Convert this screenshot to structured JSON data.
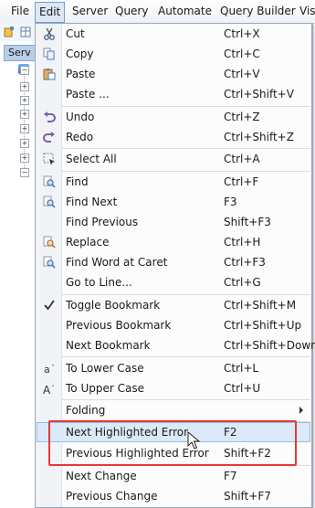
{
  "menubar": {
    "items": [
      {
        "label": "File"
      },
      {
        "label": "Edit"
      },
      {
        "label": "Server"
      },
      {
        "label": "Query"
      },
      {
        "label": "Automate"
      },
      {
        "label": "Query Builder"
      },
      {
        "label": "Visu"
      }
    ]
  },
  "background": {
    "tab_label": "Serv"
  },
  "menu": {
    "items": [
      {
        "label": "Cut",
        "shortcut": "Ctrl+X",
        "icon": "scissors-icon"
      },
      {
        "label": "Copy",
        "shortcut": "Ctrl+C",
        "icon": "copy-icon"
      },
      {
        "label": "Paste",
        "shortcut": "Ctrl+V",
        "icon": "paste-icon"
      },
      {
        "label": "Paste ...",
        "shortcut": "Ctrl+Shift+V",
        "icon": ""
      },
      {
        "label": "Undo",
        "shortcut": "Ctrl+Z",
        "icon": "undo-icon"
      },
      {
        "label": "Redo",
        "shortcut": "Ctrl+Shift+Z",
        "icon": "redo-icon"
      },
      {
        "label": "Select All",
        "shortcut": "Ctrl+A",
        "icon": "select-all-icon"
      },
      {
        "label": "Find",
        "shortcut": "Ctrl+F",
        "icon": "find-icon"
      },
      {
        "label": "Find Next",
        "shortcut": "F3",
        "icon": "find-next-icon"
      },
      {
        "label": "Find Previous",
        "shortcut": "Shift+F3",
        "icon": ""
      },
      {
        "label": "Replace",
        "shortcut": "Ctrl+H",
        "icon": "replace-icon"
      },
      {
        "label": "Find Word at Caret",
        "shortcut": "Ctrl+F3",
        "icon": "find-word-icon"
      },
      {
        "label": "Go to Line...",
        "shortcut": "Ctrl+G",
        "icon": ""
      },
      {
        "label": "Toggle Bookmark",
        "shortcut": "Ctrl+Shift+M",
        "icon": "checkmark-icon"
      },
      {
        "label": "Previous Bookmark",
        "shortcut": "Ctrl+Shift+Up",
        "icon": ""
      },
      {
        "label": "Next Bookmark",
        "shortcut": "Ctrl+Shift+Down",
        "icon": ""
      },
      {
        "label": "To Lower Case",
        "shortcut": "Ctrl+L",
        "icon": "lowercase-icon"
      },
      {
        "label": "To Upper Case",
        "shortcut": "Ctrl+U",
        "icon": "uppercase-icon"
      },
      {
        "label": "Folding",
        "shortcut": "",
        "icon": ""
      },
      {
        "label": "Next Highlighted Error",
        "shortcut": "F2",
        "icon": ""
      },
      {
        "label": "Previous Highlighted Error",
        "shortcut": "Shift+F2",
        "icon": ""
      },
      {
        "label": "Next Change",
        "shortcut": "F7",
        "icon": ""
      },
      {
        "label": "Previous Change",
        "shortcut": "Shift+F7",
        "icon": ""
      }
    ]
  },
  "colors": {
    "highlight_box": "#e53935",
    "hover_bg": "#dbe9f8",
    "icon_blue": "#2f6db5",
    "icon_purple": "#7b5ea7"
  }
}
